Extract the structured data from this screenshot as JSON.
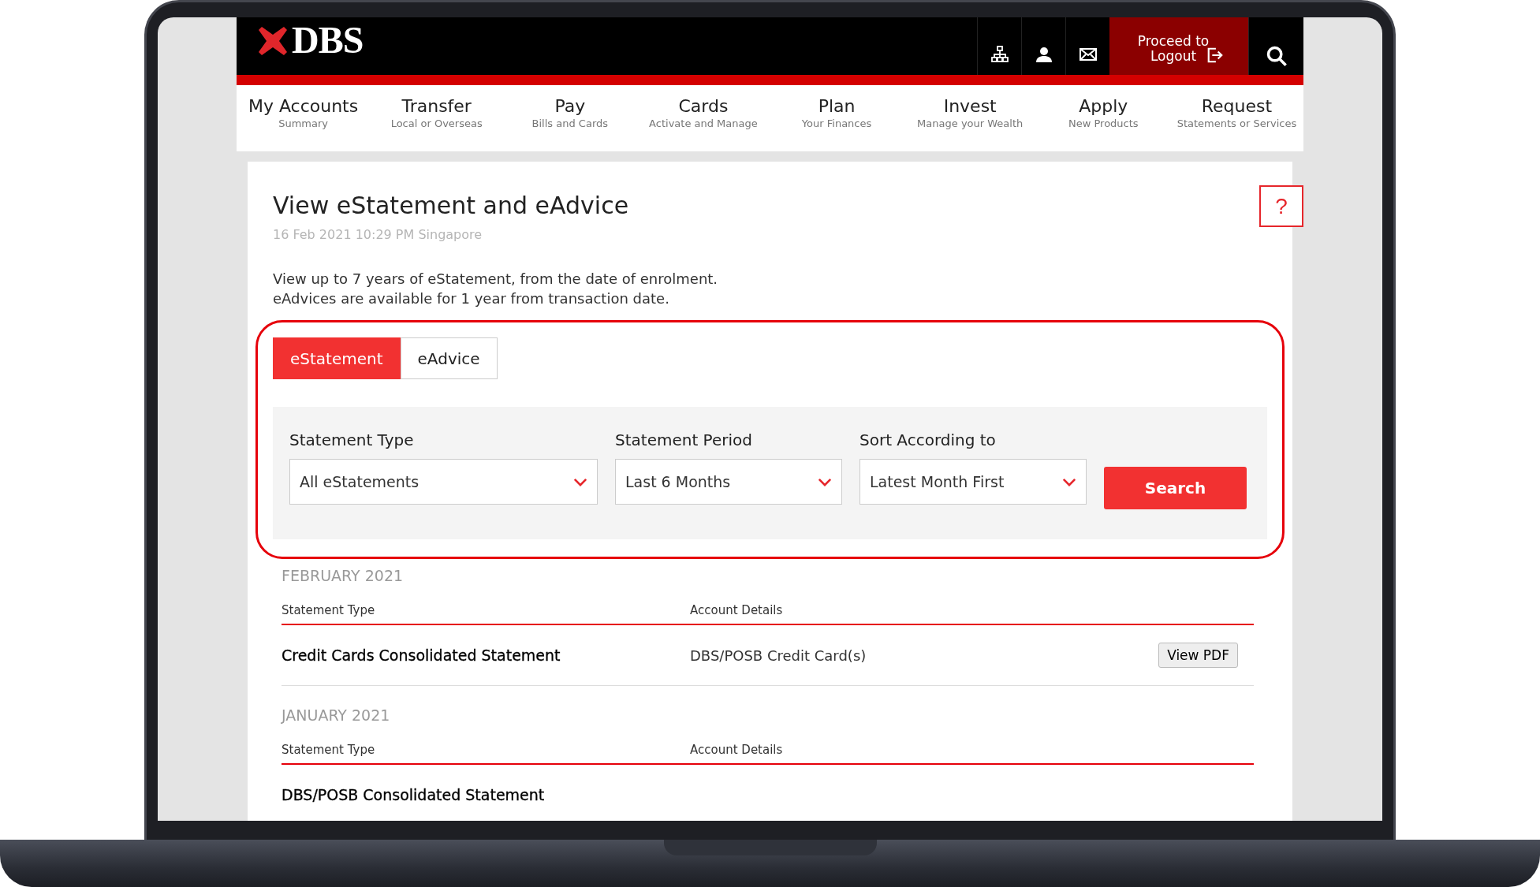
{
  "header": {
    "logo": "DBS",
    "logout": "Proceed to Logout"
  },
  "nav": [
    {
      "label": "My Accounts",
      "sub": "Summary"
    },
    {
      "label": "Transfer",
      "sub": "Local or Overseas"
    },
    {
      "label": "Pay",
      "sub": "Bills and Cards"
    },
    {
      "label": "Cards",
      "sub": "Activate and Manage"
    },
    {
      "label": "Plan",
      "sub": "Your Finances"
    },
    {
      "label": "Invest",
      "sub": "Manage your Wealth"
    },
    {
      "label": "Apply",
      "sub": "New Products"
    },
    {
      "label": "Request",
      "sub": "Statements or Services"
    }
  ],
  "page": {
    "title": "View eStatement and eAdvice",
    "timestamp": "16 Feb 2021 10:29 PM Singapore",
    "help": "?",
    "intro": [
      "View up to 7 years of eStatement, from the date of enrolment.",
      "eAdvices are available for 1 year from transaction date."
    ]
  },
  "tabs": [
    {
      "label": "eStatement",
      "selected": true
    },
    {
      "label": "eAdvice",
      "selected": false
    }
  ],
  "filters": [
    {
      "label": "Statement Type",
      "value": "All eStatements"
    },
    {
      "label": "Statement Period",
      "value": "Last 6 Months"
    },
    {
      "label": "Sort According to",
      "value": "Latest Month First"
    }
  ],
  "search_button": "Search",
  "sections": [
    {
      "month": "FEBRUARY 2021",
      "columns": [
        "Statement Type",
        "Account Details"
      ],
      "rows": [
        {
          "type": "Credit Cards Consolidated Statement",
          "account": "DBS/POSB Credit Card(s)",
          "action": "View PDF"
        }
      ]
    },
    {
      "month": "JANUARY 2021",
      "columns": [
        "Statement Type",
        "Account Details"
      ],
      "rows": [
        {
          "type": "DBS/POSB Consolidated Statement"
        }
      ]
    }
  ]
}
